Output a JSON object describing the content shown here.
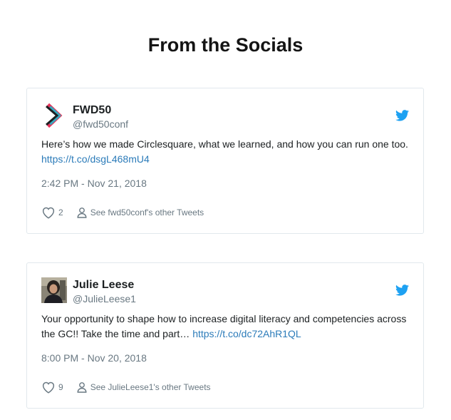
{
  "page": {
    "title": "From the Socials"
  },
  "tweets": [
    {
      "author_name": "FWD50",
      "handle": "@fwd50conf",
      "text": "Here’s how we made Circlesquare, what we learned, and how you can run one too.",
      "link": "https://t.co/dsgL468mU4",
      "timestamp": "2:42 PM - Nov 21, 2018",
      "likes": "2",
      "profile_link": "See fwd50conf's other Tweets",
      "avatar_icon": "fwd50-logo-icon"
    },
    {
      "author_name": "Julie Leese",
      "handle": "@JulieLeese1",
      "text": "Your opportunity to shape how to increase digital literacy and competencies across the GC!! Take the time and part… ",
      "link": "https://t.co/dc72AhR1QL",
      "timestamp": "8:00 PM - Nov 20, 2018",
      "likes": "9",
      "profile_link": "See JulieLeese1's other Tweets",
      "avatar_icon": "profile-photo"
    }
  ],
  "colors": {
    "twitter_blue": "#1da1f2",
    "link": "#2b7bb9",
    "muted": "#697882",
    "fwd50_pink": "#e6335a",
    "fwd50_teal": "#22b5c9"
  }
}
